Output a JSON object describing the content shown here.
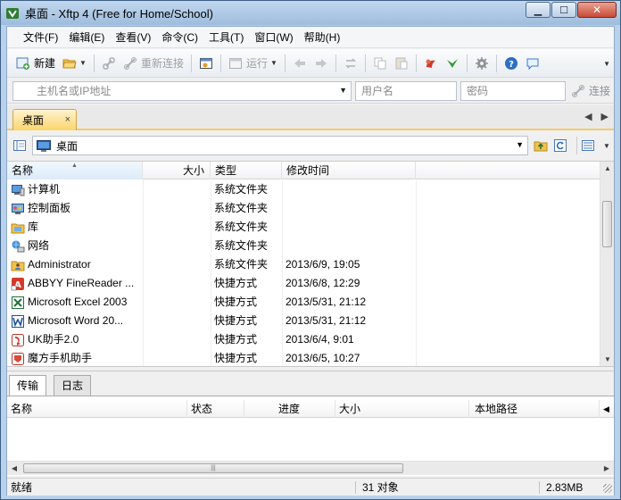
{
  "window": {
    "title": "桌面 - Xftp 4 (Free for Home/School)",
    "controls": {
      "minimize": "▁",
      "maximize": "☐",
      "close": "✕"
    }
  },
  "menu": [
    "文件(F)",
    "编辑(E)",
    "查看(V)",
    "命令(C)",
    "工具(T)",
    "窗口(W)",
    "帮助(H)"
  ],
  "toolbar": {
    "new_label": "新建",
    "reconnect_label": "重新连接",
    "run_label": "运行"
  },
  "address": {
    "host_placeholder": "主机名或IP地址",
    "user_placeholder": "用户名",
    "password_placeholder": "密码",
    "connect_label": "连接"
  },
  "tab": {
    "label": "桌面",
    "close": "×"
  },
  "tab_nav": {
    "prev": "◀",
    "next": "▶"
  },
  "path": {
    "current": "桌面"
  },
  "file_list": {
    "columns": {
      "name": "名称",
      "size": "大小",
      "type": "类型",
      "modified": "修改时间"
    },
    "rows": [
      {
        "name": "计算机",
        "size": "",
        "type": "系统文件夹",
        "modified": "",
        "icon": "computer-icon"
      },
      {
        "name": "控制面板",
        "size": "",
        "type": "系统文件夹",
        "modified": "",
        "icon": "control-panel-icon"
      },
      {
        "name": "库",
        "size": "",
        "type": "系统文件夹",
        "modified": "",
        "icon": "library-icon"
      },
      {
        "name": "网络",
        "size": "",
        "type": "系统文件夹",
        "modified": "",
        "icon": "network-icon"
      },
      {
        "name": "Administrator",
        "size": "",
        "type": "系统文件夹",
        "modified": "2013/6/9, 19:05",
        "icon": "user-folder-icon"
      },
      {
        "name": "ABBYY FineReader ...",
        "size": "",
        "type": "快捷方式",
        "modified": "2013/6/8, 12:29",
        "icon": "shortcut-icon"
      },
      {
        "name": "Microsoft Excel 2003",
        "size": "",
        "type": "快捷方式",
        "modified": "2013/5/31, 21:12",
        "icon": "excel-icon"
      },
      {
        "name": "Microsoft Word 20...",
        "size": "",
        "type": "快捷方式",
        "modified": "2013/5/31, 21:12",
        "icon": "word-icon"
      },
      {
        "name": "UK助手2.0",
        "size": "",
        "type": "快捷方式",
        "modified": "2013/6/4, 9:01",
        "icon": "shortcut-icon"
      },
      {
        "name": "魔方手机助手",
        "size": "",
        "type": "快捷方式",
        "modified": "2013/6/5, 10:27",
        "icon": "shortcut-icon"
      }
    ]
  },
  "lower_tabs": [
    "传输",
    "日志"
  ],
  "transfer": {
    "columns": [
      "名称",
      "状态",
      "进度",
      "大小",
      "本地路径"
    ]
  },
  "status": {
    "state": "就绪",
    "objects": "31 对象",
    "size": "2.83MB"
  }
}
